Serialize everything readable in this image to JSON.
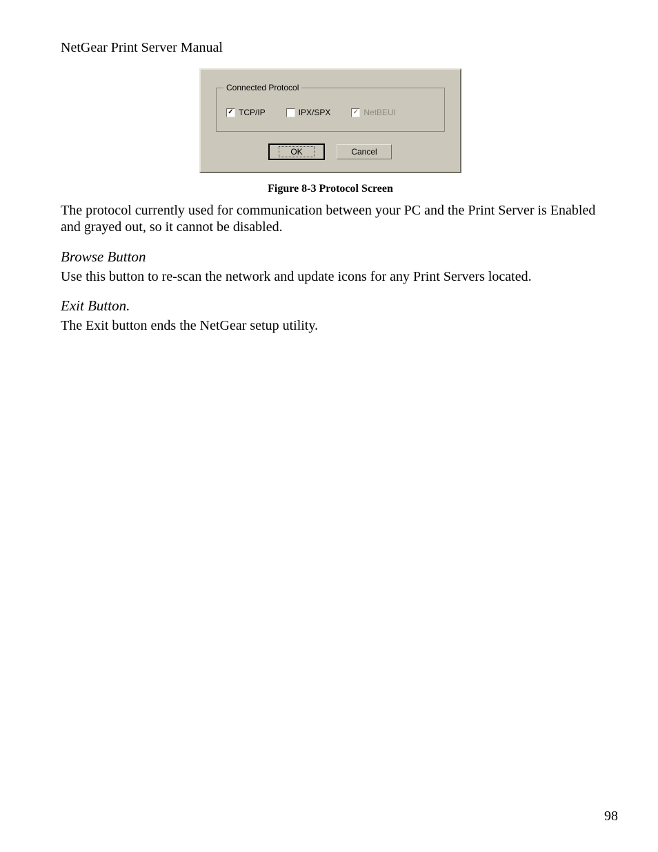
{
  "header": "NetGear Print Server Manual",
  "dialog": {
    "group_title": "Connected Protocol",
    "checks": {
      "tcpip": {
        "label": "TCP/IP",
        "checked": true,
        "disabled": false
      },
      "ipxspx": {
        "label": "IPX/SPX",
        "checked": false,
        "disabled": false
      },
      "netbeui": {
        "label": "NetBEUI",
        "checked": true,
        "disabled": true
      }
    },
    "ok_label": "OK",
    "cancel_label": "Cancel"
  },
  "figure_caption": "Figure 8-3 Protocol Screen",
  "paragraphs": {
    "proto_text": "The protocol currently used for communication between your PC and the Print Server is Enabled and grayed out, so it cannot be disabled.",
    "browse_head": "Browse Button",
    "browse_text": "Use this button to re-scan the network and update icons for any Print Servers located.",
    "exit_head": "Exit Button.",
    "exit_text": "The Exit button ends the NetGear setup utility."
  },
  "page_number": "98"
}
